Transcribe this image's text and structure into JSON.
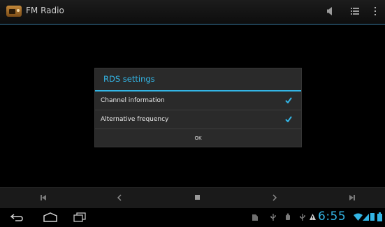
{
  "action_bar": {
    "title": "FM Radio",
    "icons": [
      "speaker-icon",
      "list-icon",
      "overflow-menu-icon"
    ]
  },
  "dialog": {
    "title": "RDS settings",
    "options": [
      {
        "label": "Channel information",
        "checked": true
      },
      {
        "label": "Alternative frequency",
        "checked": true
      }
    ],
    "ok_label": "OK"
  },
  "media_bar": {
    "icons": [
      "skip-previous-icon",
      "seek-back-icon",
      "stop-icon",
      "seek-forward-icon",
      "skip-next-icon"
    ]
  },
  "status_bar": {
    "time": "6:55",
    "icons": [
      "usb-icon",
      "sd-card-icon",
      "warning-icon",
      "wifi-icon",
      "signal-icon",
      "battery-icon"
    ]
  },
  "colors": {
    "accent": "#33b5e5",
    "dialog_bg": "#2a2a2a"
  }
}
